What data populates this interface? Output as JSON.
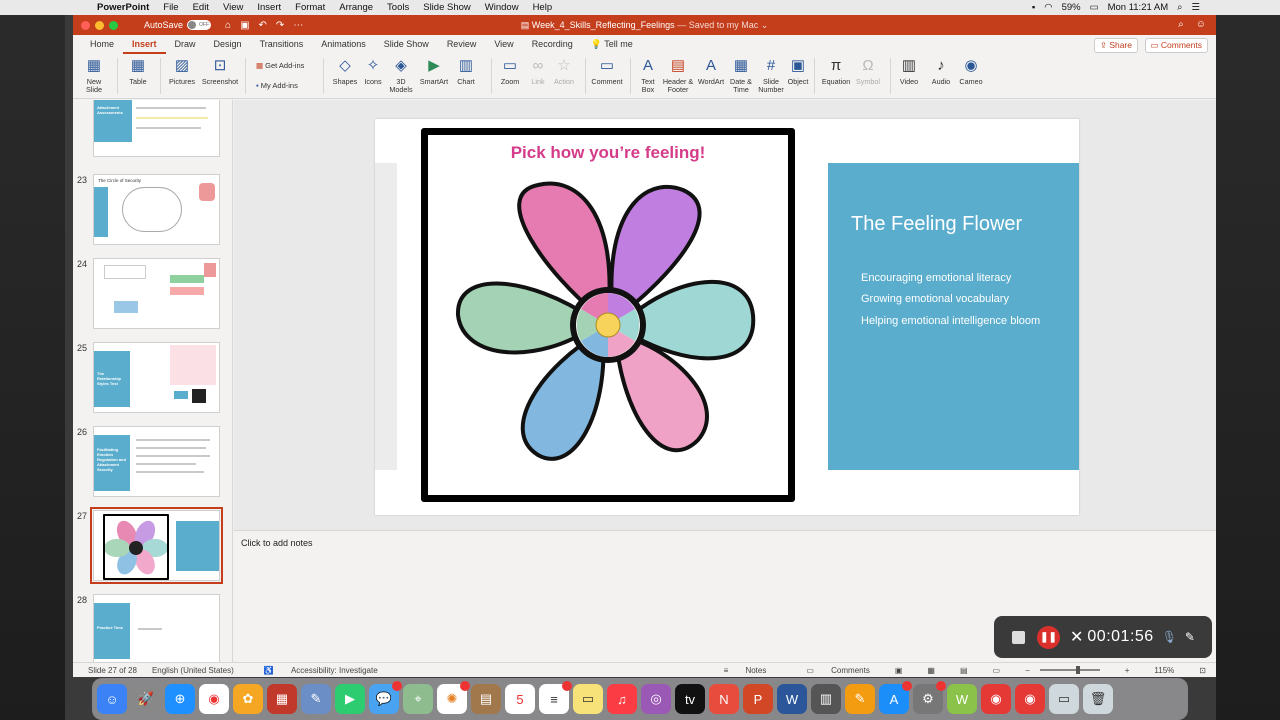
{
  "menubar": {
    "app_name": "PowerPoint",
    "items": [
      "File",
      "Edit",
      "View",
      "Insert",
      "Format",
      "Arrange",
      "Tools",
      "Slide Show",
      "Window",
      "Help"
    ],
    "battery": "59%",
    "datetime": "Mon 11:21 AM"
  },
  "titlebar": {
    "autosave_label": "AutoSave",
    "autosave_state": "OFF",
    "doc_name": "Week_4_Skills_Reflecting_Feelings",
    "saved_status": "— Saved to my Mac ⌄"
  },
  "tabs": [
    "Home",
    "Insert",
    "Draw",
    "Design",
    "Transitions",
    "Animations",
    "Slide Show",
    "Review",
    "View",
    "Recording"
  ],
  "active_tab": "Insert",
  "tell_me": "Tell me",
  "share_label": "Share",
  "comments_label": "Comments",
  "ribbon": {
    "new_slide": "New Slide",
    "table": "Table",
    "pictures": "Pictures",
    "screenshot": "Screenshot",
    "get_addins": "Get Add-ins",
    "my_addins": "My Add-ins",
    "shapes": "Shapes",
    "icons": "Icons",
    "models3d": "3D Models",
    "smartart": "SmartArt",
    "chart": "Chart",
    "zoom": "Zoom",
    "link": "Link",
    "action": "Action",
    "comment": "Comment",
    "textbox": "Text Box",
    "header_footer": "Header & Footer",
    "wordart": "WordArt",
    "date_time": "Date & Time",
    "slide_number": "Slide Number",
    "object": "Object",
    "equation": "Equation",
    "symbol": "Symbol",
    "video": "Video",
    "audio": "Audio",
    "cameo": "Cameo"
  },
  "thumbnails": {
    "n23": "23",
    "n24": "24",
    "n25": "25",
    "n26": "26",
    "n27": "27",
    "n28": "28",
    "t22_title": "Attachment Assessments",
    "t23_title": "The Circle of Security",
    "t25_title": "The Relationship Styles Test",
    "t26_title": "Facilitating Emotion Regulation and Attachment Security",
    "t28_title": "Practice Time"
  },
  "slide": {
    "picture_title": "Pick how you’re feeling!",
    "panel_title": "The Feeling Flower",
    "bullets": [
      "Encouraging emotional literacy",
      "Growing emotional vocabulary",
      "Helping emotional intelligence bloom"
    ]
  },
  "notes_placeholder": "Click to add notes",
  "status": {
    "slide_of": "Slide 27 of 28",
    "language": "English (United States)",
    "accessibility": "Accessibility: Investigate",
    "notes": "Notes",
    "comments": "Comments",
    "zoom": "115%"
  },
  "recorder": {
    "time": "00:01:56"
  }
}
